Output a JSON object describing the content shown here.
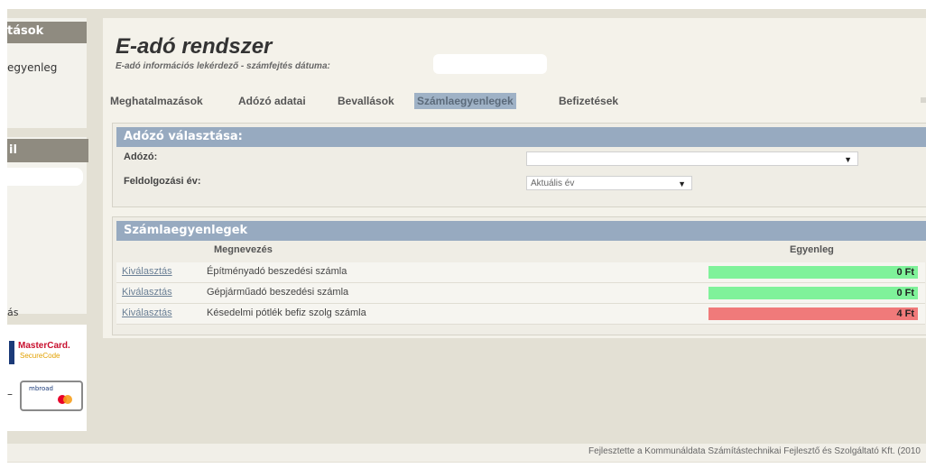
{
  "sidebar": {
    "section1_head": "tások",
    "section1_item": "egyenleg",
    "section2_head": "il",
    "bottom_text": "ás",
    "dash_text": "–",
    "mastercard_title": "MasterCard.",
    "mastercard_sub": "SecureCode",
    "checkout_text": "mbroad"
  },
  "header": {
    "title": "E-adó rendszer",
    "subtitle": "E-adó információs lekérdező - számfejtés dátuma:"
  },
  "nav": {
    "items": [
      {
        "label": "Meghatalmazások"
      },
      {
        "label": "Adózó adatai"
      },
      {
        "label": "Bevallások"
      },
      {
        "label": "Számlaegyenlegek",
        "active": true
      },
      {
        "label": "Befizetések"
      }
    ]
  },
  "taxpayer_panel": {
    "title": "Adózó választása:",
    "taxpayer_label": "Adózó:",
    "taxpayer_value": "",
    "year_label": "Feldolgozási év:",
    "year_value": "Aktuális év"
  },
  "balances_panel": {
    "title": "Számlaegyenlegek",
    "col_name": "Megnevezés",
    "col_balance": "Egyenleg",
    "rows": [
      {
        "link": "Kiválasztás",
        "name": "Építményadó beszedési számla",
        "balance": "0 Ft",
        "color": "#7ff29a"
      },
      {
        "link": "Kiválasztás",
        "name": "Gépjárműadó beszedési számla",
        "balance": "0 Ft",
        "color": "#7ff29a"
      },
      {
        "link": "Kiválasztás",
        "name": "Késedelmi pótlék befiz szolg számla",
        "balance": "4 Ft",
        "color": "#f07a7a"
      }
    ]
  },
  "footer": {
    "text": "Fejlesztette a Kommunáldata Számítástechnikai Fejlesztő és Szolgáltató Kft. (2010"
  }
}
